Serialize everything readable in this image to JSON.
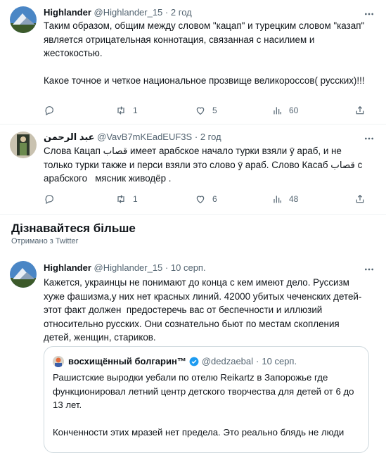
{
  "tweets": [
    {
      "author_name": "Highlander",
      "handle": "@Highlander_15",
      "time": "2 год",
      "text": "Таким образом, общим между словом \"кацап\" и турецким словом \"казап\" является отрицательная коннотация, связанная с насилием и жестокостью.\n\nКакое точное и четкое национальное прозвище великороссов( русских)!!!",
      "reply_count": "",
      "retweet_count": "1",
      "like_count": "5",
      "view_count": "60"
    },
    {
      "author_name": "عبد الرحمن",
      "handle": "@VavB7mKEadEUF3S",
      "time": "2 год",
      "text": "Слова Кацап قصاب имеет арабское начало турки взяли ӯ араб, и не только турки также и перси взяли это слово ӯ араб. Слово Касаб قصاب с арабского   мясник живодёр .",
      "reply_count": "",
      "retweet_count": "1",
      "like_count": "6",
      "view_count": "48"
    }
  ],
  "section": {
    "title": "Дізнавайтеся більше",
    "subtitle": "Отримано з Twitter"
  },
  "featured_tweet": {
    "author_name": "Highlander",
    "handle": "@Highlander_15",
    "time": "10 серп.",
    "text": "Кажется, украинцы не понимают до конца с кем имеют дело. Руссизм хуже фашизма,у них нет красных линий. 42000 убитых чеченских детей- этот факт должен  предостеречь вас от беспечности и иллюзий относительно русских. Они сознательно бьют по местам скопления детей, женщин, стариков.",
    "quote": {
      "author_name": "восхищённый болгарин™",
      "handle": "@dedzaebal",
      "time": "10 серп.",
      "text": "Рашистские выродки уебали по отелю Reikartz в Запорожье где функционировал летний центр детского творчества для детей от 6 до 13 лет.\n\nКонченности этих мразей нет предела. Это реально блядь не люди"
    }
  },
  "colors": {
    "muted": "#536471",
    "border": "#eff3f4",
    "verified": "#1d9bf0"
  },
  "icons": [
    "reply-icon",
    "retweet-icon",
    "like-icon",
    "views-icon",
    "share-icon",
    "more-icon",
    "verified-icon"
  ]
}
